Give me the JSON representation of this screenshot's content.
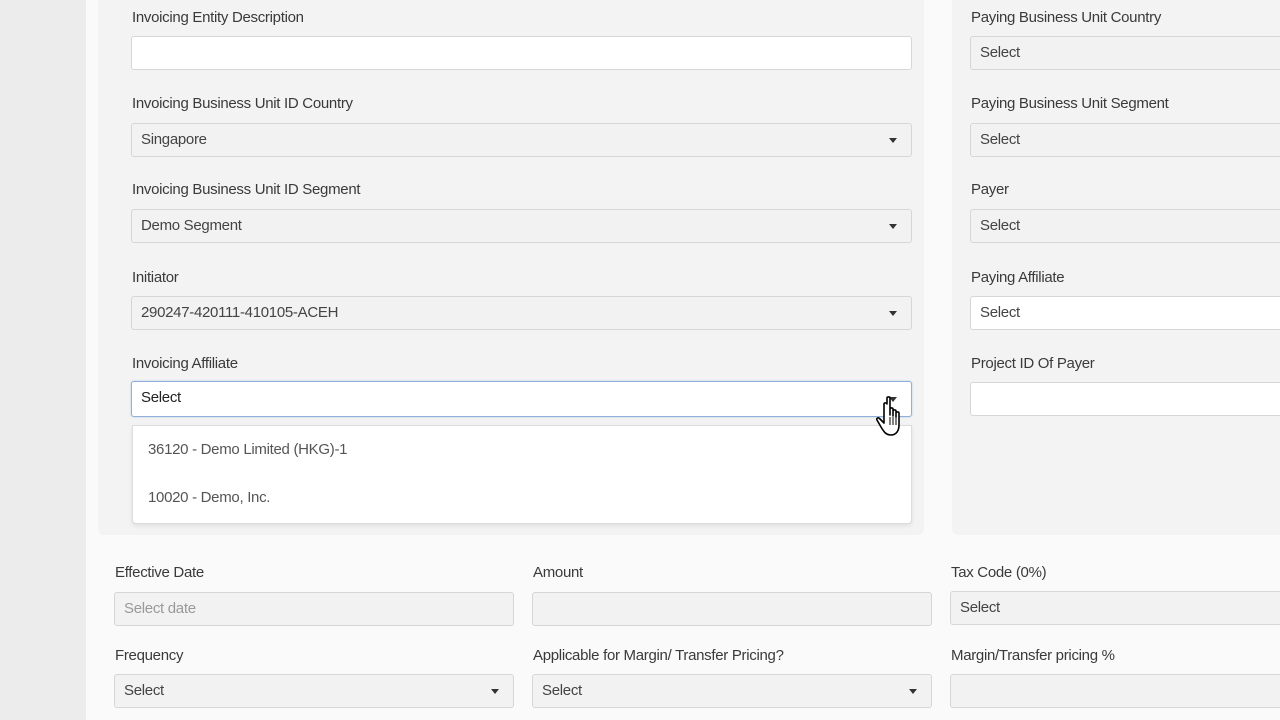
{
  "left_column": {
    "invoicing_entity_description": {
      "label": "Invoicing Entity Description",
      "value": ""
    },
    "invoicing_bu_country": {
      "label": "Invoicing Business Unit ID Country",
      "value": "Singapore"
    },
    "invoicing_bu_segment": {
      "label": "Invoicing Business Unit ID Segment",
      "value": "Demo Segment"
    },
    "initiator": {
      "label": "Initiator",
      "value": "290247-420111-410105-ACEH"
    },
    "invoicing_affiliate": {
      "label": "Invoicing Affiliate",
      "value": "Select",
      "options": [
        "36120 - Demo Limited (HKG)-1",
        "10020 - Demo, Inc."
      ]
    }
  },
  "right_column": {
    "paying_bu_country": {
      "label": "Paying Business Unit Country",
      "value": "Select"
    },
    "paying_bu_segment": {
      "label": "Paying Business Unit Segment",
      "value": "Select"
    },
    "payer": {
      "label": "Payer",
      "value": "Select"
    },
    "paying_affiliate": {
      "label": "Paying Affiliate",
      "value": "Select"
    },
    "project_id_of_payer": {
      "label": "Project ID Of Payer",
      "value": ""
    }
  },
  "bottom": {
    "effective_date": {
      "label": "Effective Date",
      "placeholder": "Select date"
    },
    "amount": {
      "label": "Amount",
      "value": ""
    },
    "tax_code": {
      "label": "Tax Code (0%)",
      "value": "Select"
    },
    "frequency": {
      "label": "Frequency",
      "value": "Select"
    },
    "margin_applicable": {
      "label": "Applicable for Margin/ Transfer Pricing?",
      "value": "Select"
    },
    "margin_percent": {
      "label": "Margin/Transfer pricing %",
      "value": ""
    }
  },
  "colors": {
    "focus_border": "#8fb0d8",
    "field_bg": "#f2f2f2",
    "panel_bg": "#f3f3f3"
  },
  "icons": {
    "caret": "caret-down-icon",
    "cursor": "hand-pointer-cursor-icon"
  }
}
